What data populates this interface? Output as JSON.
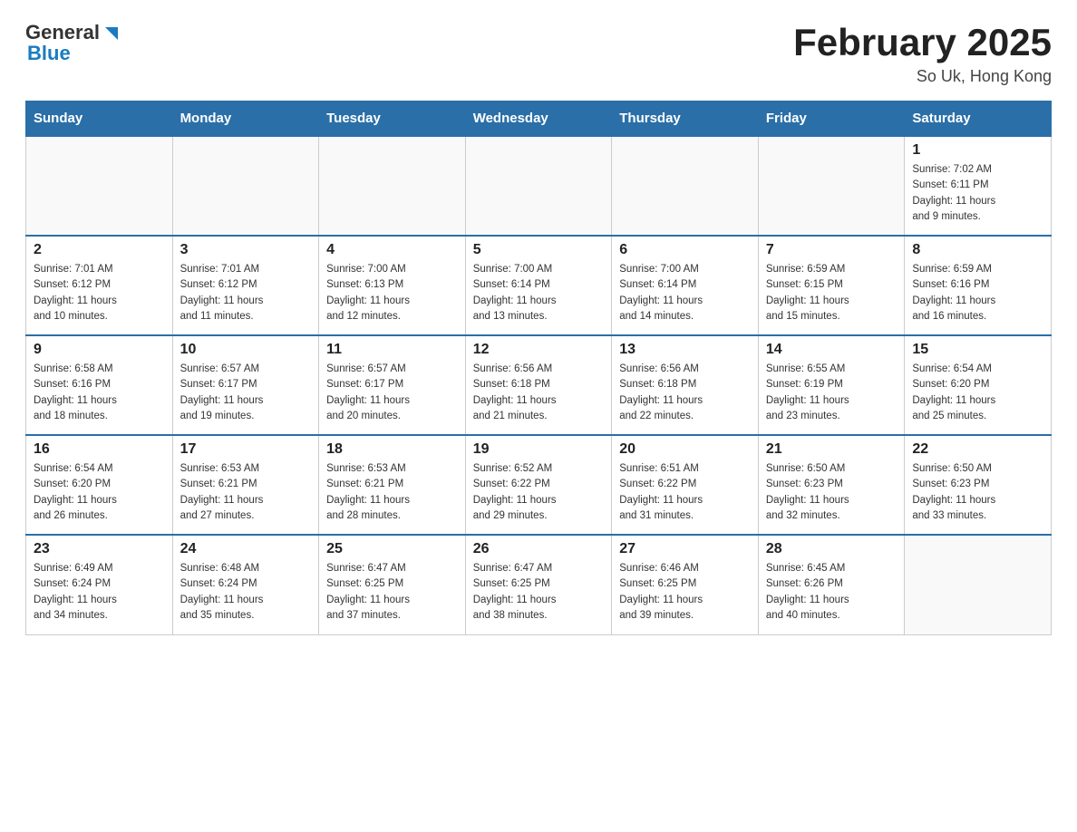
{
  "header": {
    "logo_general": "General",
    "logo_blue": "Blue",
    "month_year": "February 2025",
    "location": "So Uk, Hong Kong"
  },
  "days_of_week": [
    "Sunday",
    "Monday",
    "Tuesday",
    "Wednesday",
    "Thursday",
    "Friday",
    "Saturday"
  ],
  "weeks": [
    [
      {
        "day": "",
        "info": ""
      },
      {
        "day": "",
        "info": ""
      },
      {
        "day": "",
        "info": ""
      },
      {
        "day": "",
        "info": ""
      },
      {
        "day": "",
        "info": ""
      },
      {
        "day": "",
        "info": ""
      },
      {
        "day": "1",
        "info": "Sunrise: 7:02 AM\nSunset: 6:11 PM\nDaylight: 11 hours\nand 9 minutes."
      }
    ],
    [
      {
        "day": "2",
        "info": "Sunrise: 7:01 AM\nSunset: 6:12 PM\nDaylight: 11 hours\nand 10 minutes."
      },
      {
        "day": "3",
        "info": "Sunrise: 7:01 AM\nSunset: 6:12 PM\nDaylight: 11 hours\nand 11 minutes."
      },
      {
        "day": "4",
        "info": "Sunrise: 7:00 AM\nSunset: 6:13 PM\nDaylight: 11 hours\nand 12 minutes."
      },
      {
        "day": "5",
        "info": "Sunrise: 7:00 AM\nSunset: 6:14 PM\nDaylight: 11 hours\nand 13 minutes."
      },
      {
        "day": "6",
        "info": "Sunrise: 7:00 AM\nSunset: 6:14 PM\nDaylight: 11 hours\nand 14 minutes."
      },
      {
        "day": "7",
        "info": "Sunrise: 6:59 AM\nSunset: 6:15 PM\nDaylight: 11 hours\nand 15 minutes."
      },
      {
        "day": "8",
        "info": "Sunrise: 6:59 AM\nSunset: 6:16 PM\nDaylight: 11 hours\nand 16 minutes."
      }
    ],
    [
      {
        "day": "9",
        "info": "Sunrise: 6:58 AM\nSunset: 6:16 PM\nDaylight: 11 hours\nand 18 minutes."
      },
      {
        "day": "10",
        "info": "Sunrise: 6:57 AM\nSunset: 6:17 PM\nDaylight: 11 hours\nand 19 minutes."
      },
      {
        "day": "11",
        "info": "Sunrise: 6:57 AM\nSunset: 6:17 PM\nDaylight: 11 hours\nand 20 minutes."
      },
      {
        "day": "12",
        "info": "Sunrise: 6:56 AM\nSunset: 6:18 PM\nDaylight: 11 hours\nand 21 minutes."
      },
      {
        "day": "13",
        "info": "Sunrise: 6:56 AM\nSunset: 6:18 PM\nDaylight: 11 hours\nand 22 minutes."
      },
      {
        "day": "14",
        "info": "Sunrise: 6:55 AM\nSunset: 6:19 PM\nDaylight: 11 hours\nand 23 minutes."
      },
      {
        "day": "15",
        "info": "Sunrise: 6:54 AM\nSunset: 6:20 PM\nDaylight: 11 hours\nand 25 minutes."
      }
    ],
    [
      {
        "day": "16",
        "info": "Sunrise: 6:54 AM\nSunset: 6:20 PM\nDaylight: 11 hours\nand 26 minutes."
      },
      {
        "day": "17",
        "info": "Sunrise: 6:53 AM\nSunset: 6:21 PM\nDaylight: 11 hours\nand 27 minutes."
      },
      {
        "day": "18",
        "info": "Sunrise: 6:53 AM\nSunset: 6:21 PM\nDaylight: 11 hours\nand 28 minutes."
      },
      {
        "day": "19",
        "info": "Sunrise: 6:52 AM\nSunset: 6:22 PM\nDaylight: 11 hours\nand 29 minutes."
      },
      {
        "day": "20",
        "info": "Sunrise: 6:51 AM\nSunset: 6:22 PM\nDaylight: 11 hours\nand 31 minutes."
      },
      {
        "day": "21",
        "info": "Sunrise: 6:50 AM\nSunset: 6:23 PM\nDaylight: 11 hours\nand 32 minutes."
      },
      {
        "day": "22",
        "info": "Sunrise: 6:50 AM\nSunset: 6:23 PM\nDaylight: 11 hours\nand 33 minutes."
      }
    ],
    [
      {
        "day": "23",
        "info": "Sunrise: 6:49 AM\nSunset: 6:24 PM\nDaylight: 11 hours\nand 34 minutes."
      },
      {
        "day": "24",
        "info": "Sunrise: 6:48 AM\nSunset: 6:24 PM\nDaylight: 11 hours\nand 35 minutes."
      },
      {
        "day": "25",
        "info": "Sunrise: 6:47 AM\nSunset: 6:25 PM\nDaylight: 11 hours\nand 37 minutes."
      },
      {
        "day": "26",
        "info": "Sunrise: 6:47 AM\nSunset: 6:25 PM\nDaylight: 11 hours\nand 38 minutes."
      },
      {
        "day": "27",
        "info": "Sunrise: 6:46 AM\nSunset: 6:25 PM\nDaylight: 11 hours\nand 39 minutes."
      },
      {
        "day": "28",
        "info": "Sunrise: 6:45 AM\nSunset: 6:26 PM\nDaylight: 11 hours\nand 40 minutes."
      },
      {
        "day": "",
        "info": ""
      }
    ]
  ]
}
